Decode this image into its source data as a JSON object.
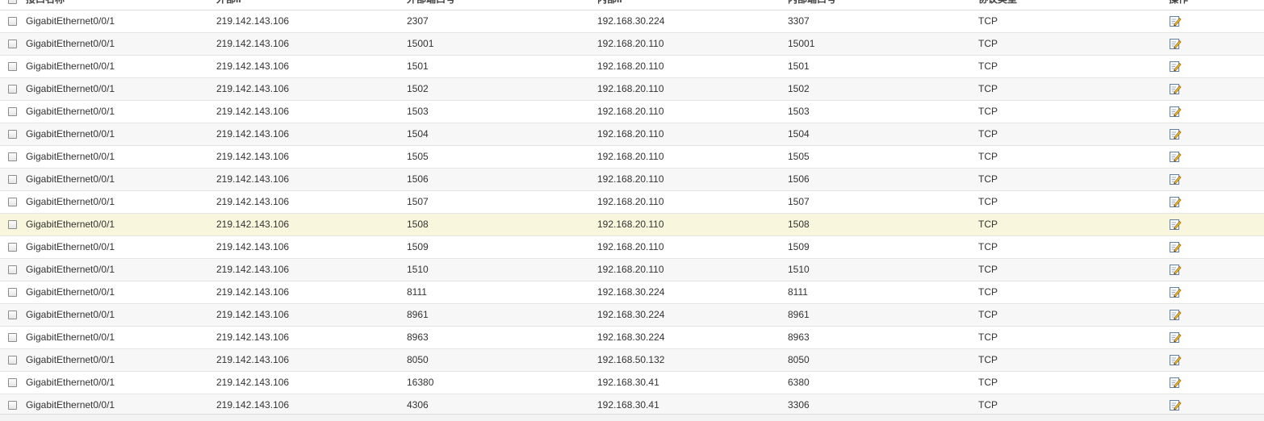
{
  "table": {
    "headers": {
      "interface": "接口名称",
      "external_ip": "外部IP",
      "external_port": "外部端口号",
      "internal_ip": "内部IP",
      "internal_port": "内部端口号",
      "protocol": "协议类型",
      "action": "操作"
    },
    "edit_icon": "edit-icon",
    "colors": {
      "row_alt": "#f7f7f7",
      "row_highlight": "#f8f6dc",
      "border": "#e4e4e4"
    },
    "rows": [
      {
        "interface": "GigabitEthernet0/0/1",
        "external_ip": "219.142.143.106",
        "external_port": "2307",
        "internal_ip": "192.168.30.224",
        "internal_port": "3307",
        "protocol": "TCP"
      },
      {
        "interface": "GigabitEthernet0/0/1",
        "external_ip": "219.142.143.106",
        "external_port": "15001",
        "internal_ip": "192.168.20.110",
        "internal_port": "15001",
        "protocol": "TCP"
      },
      {
        "interface": "GigabitEthernet0/0/1",
        "external_ip": "219.142.143.106",
        "external_port": "1501",
        "internal_ip": "192.168.20.110",
        "internal_port": "1501",
        "protocol": "TCP"
      },
      {
        "interface": "GigabitEthernet0/0/1",
        "external_ip": "219.142.143.106",
        "external_port": "1502",
        "internal_ip": "192.168.20.110",
        "internal_port": "1502",
        "protocol": "TCP"
      },
      {
        "interface": "GigabitEthernet0/0/1",
        "external_ip": "219.142.143.106",
        "external_port": "1503",
        "internal_ip": "192.168.20.110",
        "internal_port": "1503",
        "protocol": "TCP"
      },
      {
        "interface": "GigabitEthernet0/0/1",
        "external_ip": "219.142.143.106",
        "external_port": "1504",
        "internal_ip": "192.168.20.110",
        "internal_port": "1504",
        "protocol": "TCP"
      },
      {
        "interface": "GigabitEthernet0/0/1",
        "external_ip": "219.142.143.106",
        "external_port": "1505",
        "internal_ip": "192.168.20.110",
        "internal_port": "1505",
        "protocol": "TCP"
      },
      {
        "interface": "GigabitEthernet0/0/1",
        "external_ip": "219.142.143.106",
        "external_port": "1506",
        "internal_ip": "192.168.20.110",
        "internal_port": "1506",
        "protocol": "TCP"
      },
      {
        "interface": "GigabitEthernet0/0/1",
        "external_ip": "219.142.143.106",
        "external_port": "1507",
        "internal_ip": "192.168.20.110",
        "internal_port": "1507",
        "protocol": "TCP"
      },
      {
        "interface": "GigabitEthernet0/0/1",
        "external_ip": "219.142.143.106",
        "external_port": "1508",
        "internal_ip": "192.168.20.110",
        "internal_port": "1508",
        "protocol": "TCP",
        "highlighted": true
      },
      {
        "interface": "GigabitEthernet0/0/1",
        "external_ip": "219.142.143.106",
        "external_port": "1509",
        "internal_ip": "192.168.20.110",
        "internal_port": "1509",
        "protocol": "TCP"
      },
      {
        "interface": "GigabitEthernet0/0/1",
        "external_ip": "219.142.143.106",
        "external_port": "1510",
        "internal_ip": "192.168.20.110",
        "internal_port": "1510",
        "protocol": "TCP"
      },
      {
        "interface": "GigabitEthernet0/0/1",
        "external_ip": "219.142.143.106",
        "external_port": "8111",
        "internal_ip": "192.168.30.224",
        "internal_port": "8111",
        "protocol": "TCP"
      },
      {
        "interface": "GigabitEthernet0/0/1",
        "external_ip": "219.142.143.106",
        "external_port": "8961",
        "internal_ip": "192.168.30.224",
        "internal_port": "8961",
        "protocol": "TCP"
      },
      {
        "interface": "GigabitEthernet0/0/1",
        "external_ip": "219.142.143.106",
        "external_port": "8963",
        "internal_ip": "192.168.30.224",
        "internal_port": "8963",
        "protocol": "TCP"
      },
      {
        "interface": "GigabitEthernet0/0/1",
        "external_ip": "219.142.143.106",
        "external_port": "8050",
        "internal_ip": "192.168.50.132",
        "internal_port": "8050",
        "protocol": "TCP"
      },
      {
        "interface": "GigabitEthernet0/0/1",
        "external_ip": "219.142.143.106",
        "external_port": "16380",
        "internal_ip": "192.168.30.41",
        "internal_port": "6380",
        "protocol": "TCP"
      },
      {
        "interface": "GigabitEthernet0/0/1",
        "external_ip": "219.142.143.106",
        "external_port": "4306",
        "internal_ip": "192.168.30.41",
        "internal_port": "3306",
        "protocol": "TCP"
      }
    ]
  }
}
